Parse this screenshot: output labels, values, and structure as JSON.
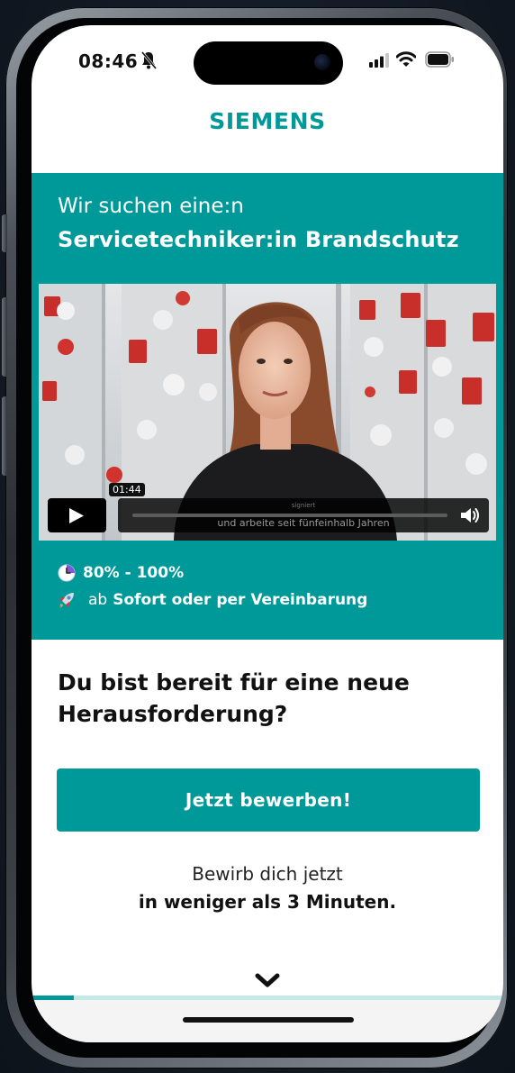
{
  "status_bar": {
    "time": "08:46"
  },
  "header": {
    "logo_text": "SIEMENS",
    "brand_color": "#009999"
  },
  "hero": {
    "intro": "Wir suchen eine:n",
    "title": "Servicetechniker:in Brandschutz",
    "video": {
      "timestamp_tooltip": "01:44",
      "caption": "und arbeite seit fünfeinhalb Jahren",
      "caption_small": "signiert",
      "controls": [
        "play-icon",
        "volume-icon"
      ]
    },
    "workload": {
      "icon": "clock-icon",
      "text": "80% - 100%"
    },
    "start_date": {
      "icon": "rocket-icon",
      "prefix": "ab",
      "text": "Sofort oder per Vereinbarung"
    }
  },
  "main": {
    "heading": "Du bist bereit für eine neue Herausforderung?",
    "apply_button": "Jetzt bewerben!",
    "sub_line_1": "Bewirb dich jetzt",
    "sub_line_2": "in weniger als 3 Minuten.",
    "scroll_icon": "chevron-down-icon",
    "progress_fraction": 0.09
  }
}
